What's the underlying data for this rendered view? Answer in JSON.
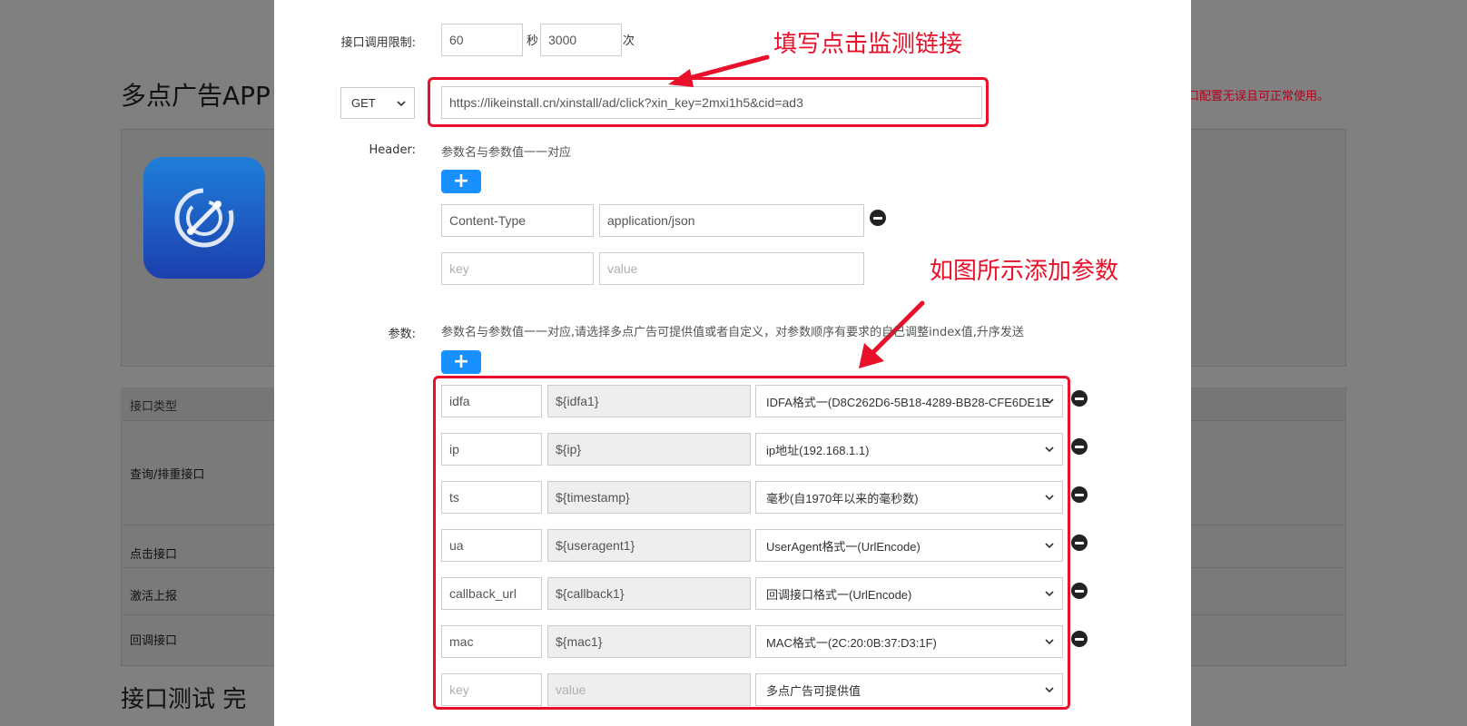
{
  "background": {
    "title": "多点广告APP",
    "note": "接口配置无误且可正常使用。",
    "table_header": "接口类型",
    "rows": [
      "查询/排重接口",
      "点击接口",
      "激活上报",
      "回调接口"
    ],
    "bottom_title": "接口测试  完"
  },
  "modal": {
    "rate_limit": {
      "label": "接口调用限制:",
      "seconds": "60",
      "seconds_unit": "秒",
      "count": "3000",
      "count_unit": "次"
    },
    "method": "GET",
    "url": "https://likeinstall.cn/xinstall/ad/click?xin_key=2mxi1h5&cid=ad3",
    "header": {
      "label": "Header:",
      "hint": "参数名与参数值一一对应",
      "rows": [
        {
          "key": "Content-Type",
          "value": "application/json"
        }
      ],
      "key_placeholder": "key",
      "value_placeholder": "value"
    },
    "params": {
      "label": "参数:",
      "hint": "参数名与参数值一一对应,请选择多点广告可提供值或者自定义，对参数顺序有要求的自己调整index值,升序发送",
      "rows": [
        {
          "key": "idfa",
          "value": "${idfa1}",
          "option": "IDFA格式一(D8C262D6-5B18-4289-BB28-CFE6DE1E"
        },
        {
          "key": "ip",
          "value": "${ip}",
          "option": "ip地址(192.168.1.1)"
        },
        {
          "key": "ts",
          "value": "${timestamp}",
          "option": "毫秒(自1970年以来的毫秒数)"
        },
        {
          "key": "ua",
          "value": "${useragent1}",
          "option": "UserAgent格式一(UrlEncode)"
        },
        {
          "key": "callback_url",
          "value": "${callback1}",
          "option": "回调接口格式一(UrlEncode)"
        },
        {
          "key": "mac",
          "value": "${mac1}",
          "option": "MAC格式一(2C:20:0B:37:D3:1F)"
        }
      ],
      "empty_row": {
        "key_placeholder": "key",
        "value_placeholder": "value",
        "option": "多点广告可提供值"
      }
    }
  },
  "annotations": {
    "url_note": "填写点击监测链接",
    "params_note": "如图所示添加参数"
  },
  "colors": {
    "accent": "#1890ff",
    "annotation": "#e8102a"
  }
}
